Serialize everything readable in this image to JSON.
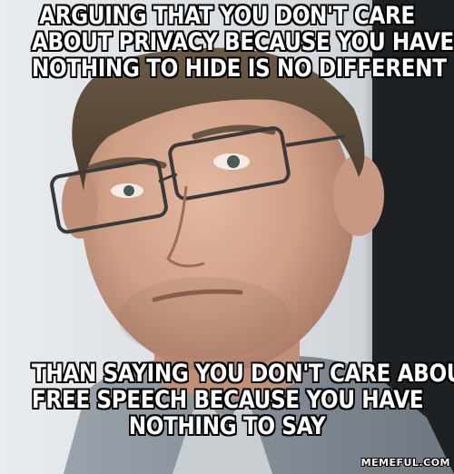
{
  "meme": {
    "top_text": {
      "lines": [
        "ARGUING THAT YOU DON'T CARE",
        "ABOUT PRIVACY BECAUSE YOU HAVE",
        "NOTHING TO HIDE IS NO DIFFERENT"
      ]
    },
    "bottom_text": {
      "lines": [
        "THAN SAYING YOU DON'T CARE ABOUT",
        "FREE SPEECH BECAUSE YOU HAVE",
        "NOTHING TO SAY"
      ]
    },
    "watermark": "MEMEFUL.COM"
  },
  "colors": {
    "caption_fill": "#ffffff",
    "caption_outline": "#000000"
  }
}
